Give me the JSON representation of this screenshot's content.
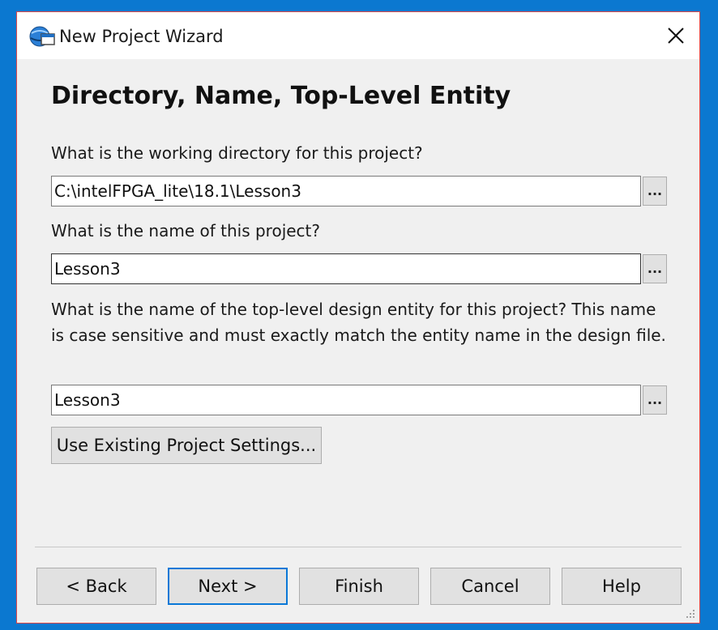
{
  "window": {
    "title": "New Project Wizard",
    "icon": "quartus-globe-icon",
    "close_icon": "close-icon"
  },
  "page": {
    "heading": "Directory, Name, Top-Level Entity"
  },
  "form": {
    "directory": {
      "question": "What is the working directory for this project?",
      "value": "C:\\intelFPGA_lite\\18.1\\Lesson3",
      "browse_label": "..."
    },
    "project_name": {
      "question": "What is the name of this project?",
      "value": "Lesson3",
      "browse_label": "..."
    },
    "top_entity": {
      "question": "What is the name of the top-level design entity for this project? This name is case sensitive and must exactly match the entity name in the design file.",
      "value": "Lesson3",
      "browse_label": "..."
    },
    "use_existing_label": "Use Existing Project Settings..."
  },
  "buttons": {
    "back": "< Back",
    "next": "Next >",
    "finish": "Finish",
    "cancel": "Cancel",
    "help": "Help"
  },
  "colors": {
    "desktop": "#0b78d0",
    "window_border": "#e04848",
    "default_button_border": "#0a78d7"
  }
}
